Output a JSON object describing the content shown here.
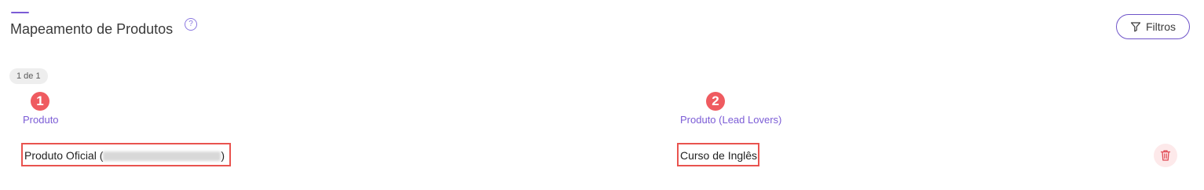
{
  "header": {
    "title": "Mapeamento de Produtos",
    "help_icon": "question-circle-icon",
    "filters_label": "Filtros"
  },
  "pagination": {
    "label": "1 de 1"
  },
  "markers": [
    "1",
    "2"
  ],
  "columns": [
    "Produto",
    "Produto (Lead Lovers)"
  ],
  "rows": [
    {
      "product_prefix": "Produto Oficial (",
      "product_suffix": ")",
      "leadlovers_product": "Curso de Inglês"
    }
  ],
  "colors": {
    "accent": "#7b5cd6",
    "highlight": "#e9534f",
    "delete": "#e04b55"
  }
}
